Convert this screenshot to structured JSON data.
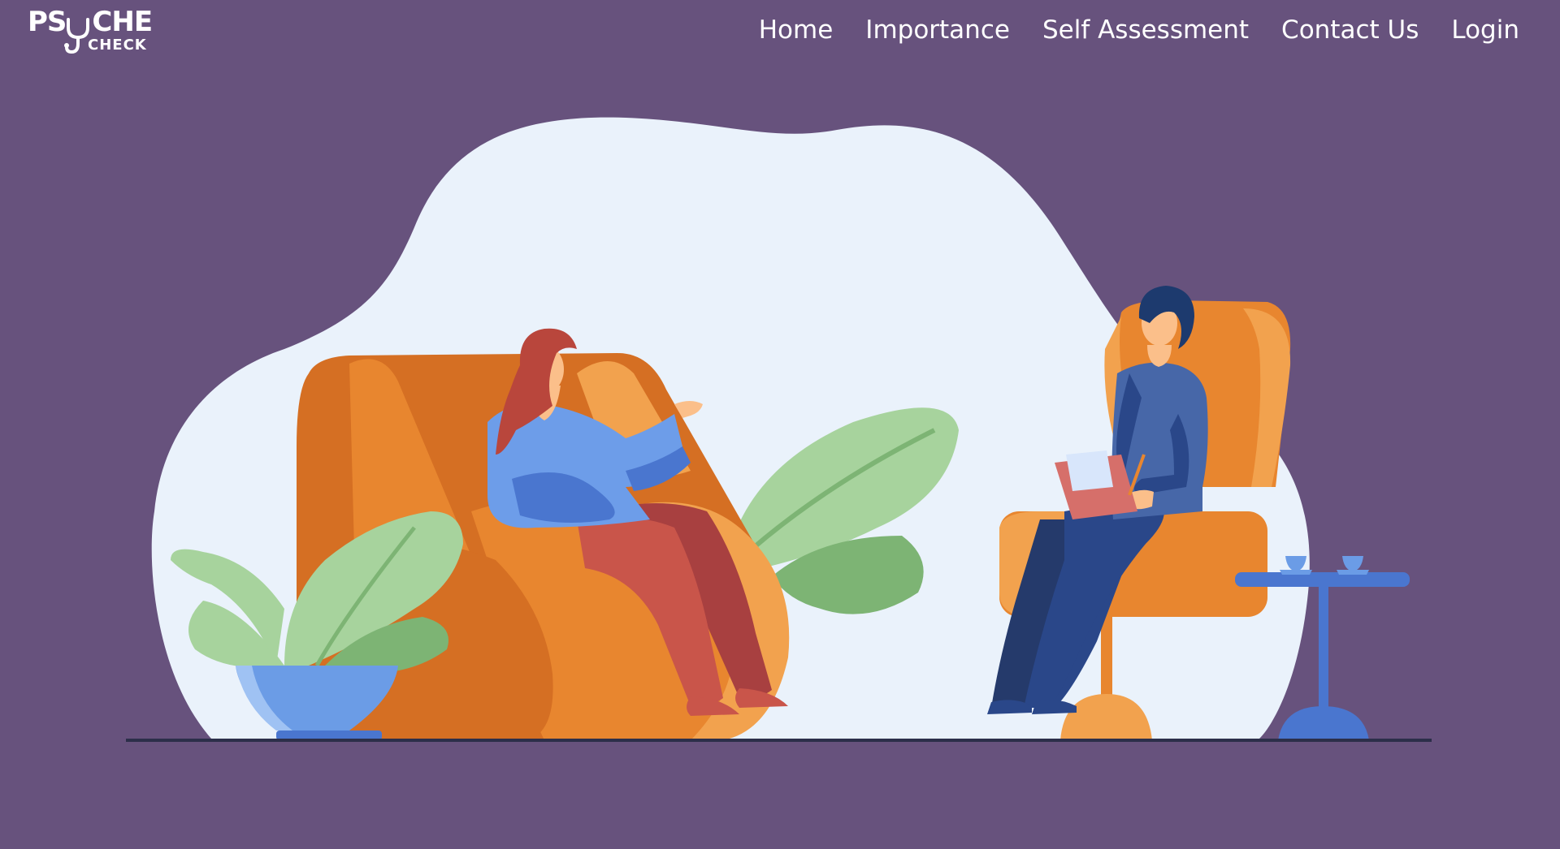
{
  "brand": {
    "logo_top_left": "PS",
    "logo_top_right": "CHE",
    "logo_bottom": "CHECK"
  },
  "nav": {
    "items": [
      {
        "label": "Home"
      },
      {
        "label": "Importance"
      },
      {
        "label": "Self Assessment"
      },
      {
        "label": "Contact Us"
      },
      {
        "label": "Login"
      }
    ]
  },
  "colors": {
    "background": "#67527d",
    "nav_text": "#ffffff",
    "blob": "#eaf2fb",
    "armchair_orange": "#e8862f",
    "armchair_light": "#f2a24e",
    "plant_green": "#a7d39d",
    "plant_dark_green": "#7db474",
    "patient_top": "#6d9de9",
    "patient_pants": "#c9554a",
    "therapist_top": "#4767a8",
    "therapist_pants": "#2a4789",
    "pot_blue": "#6b9ce6",
    "floor_line": "#2c2f4a"
  },
  "hero": {
    "illustration": "therapy-session-illustration"
  }
}
